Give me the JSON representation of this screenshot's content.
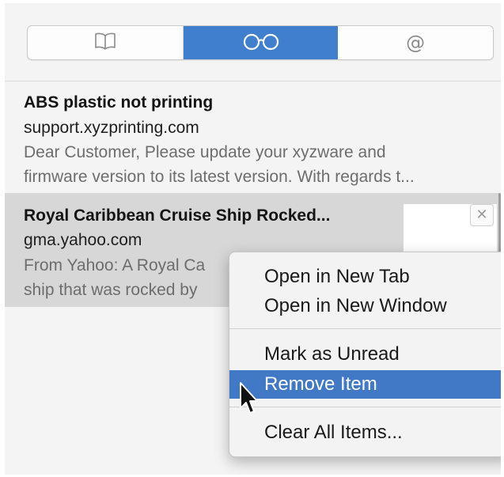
{
  "tabs": [
    {
      "name": "bookmarks",
      "icon": "book-icon"
    },
    {
      "name": "reading-list",
      "icon": "glasses-icon",
      "active": true
    },
    {
      "name": "shared-links",
      "icon": "at-icon",
      "glyph": "@"
    }
  ],
  "reading_list": {
    "items": [
      {
        "title": "ABS plastic not printing",
        "url": "support.xyzprinting.com",
        "desc_line1": "Dear Customer, Please update your xyzware and",
        "desc_line2": "firmware version to its latest version. With regards t..."
      },
      {
        "title": "Royal Caribbean Cruise Ship Rocked...",
        "url": "gma.yahoo.com",
        "desc_line1": "From Yahoo: A Royal Ca",
        "desc_line2": "ship that was rocked by",
        "close_glyph": "✕"
      }
    ]
  },
  "context_menu": {
    "items": [
      "Open in New Tab",
      "Open in New Window",
      "Mark as Unread",
      "Remove Item",
      "Clear All Items..."
    ],
    "highlighted_index": 3
  },
  "colors": {
    "accent": "#3f7fce",
    "selected_row": "#d7d7d7",
    "menu_highlight": "#4179c6"
  }
}
